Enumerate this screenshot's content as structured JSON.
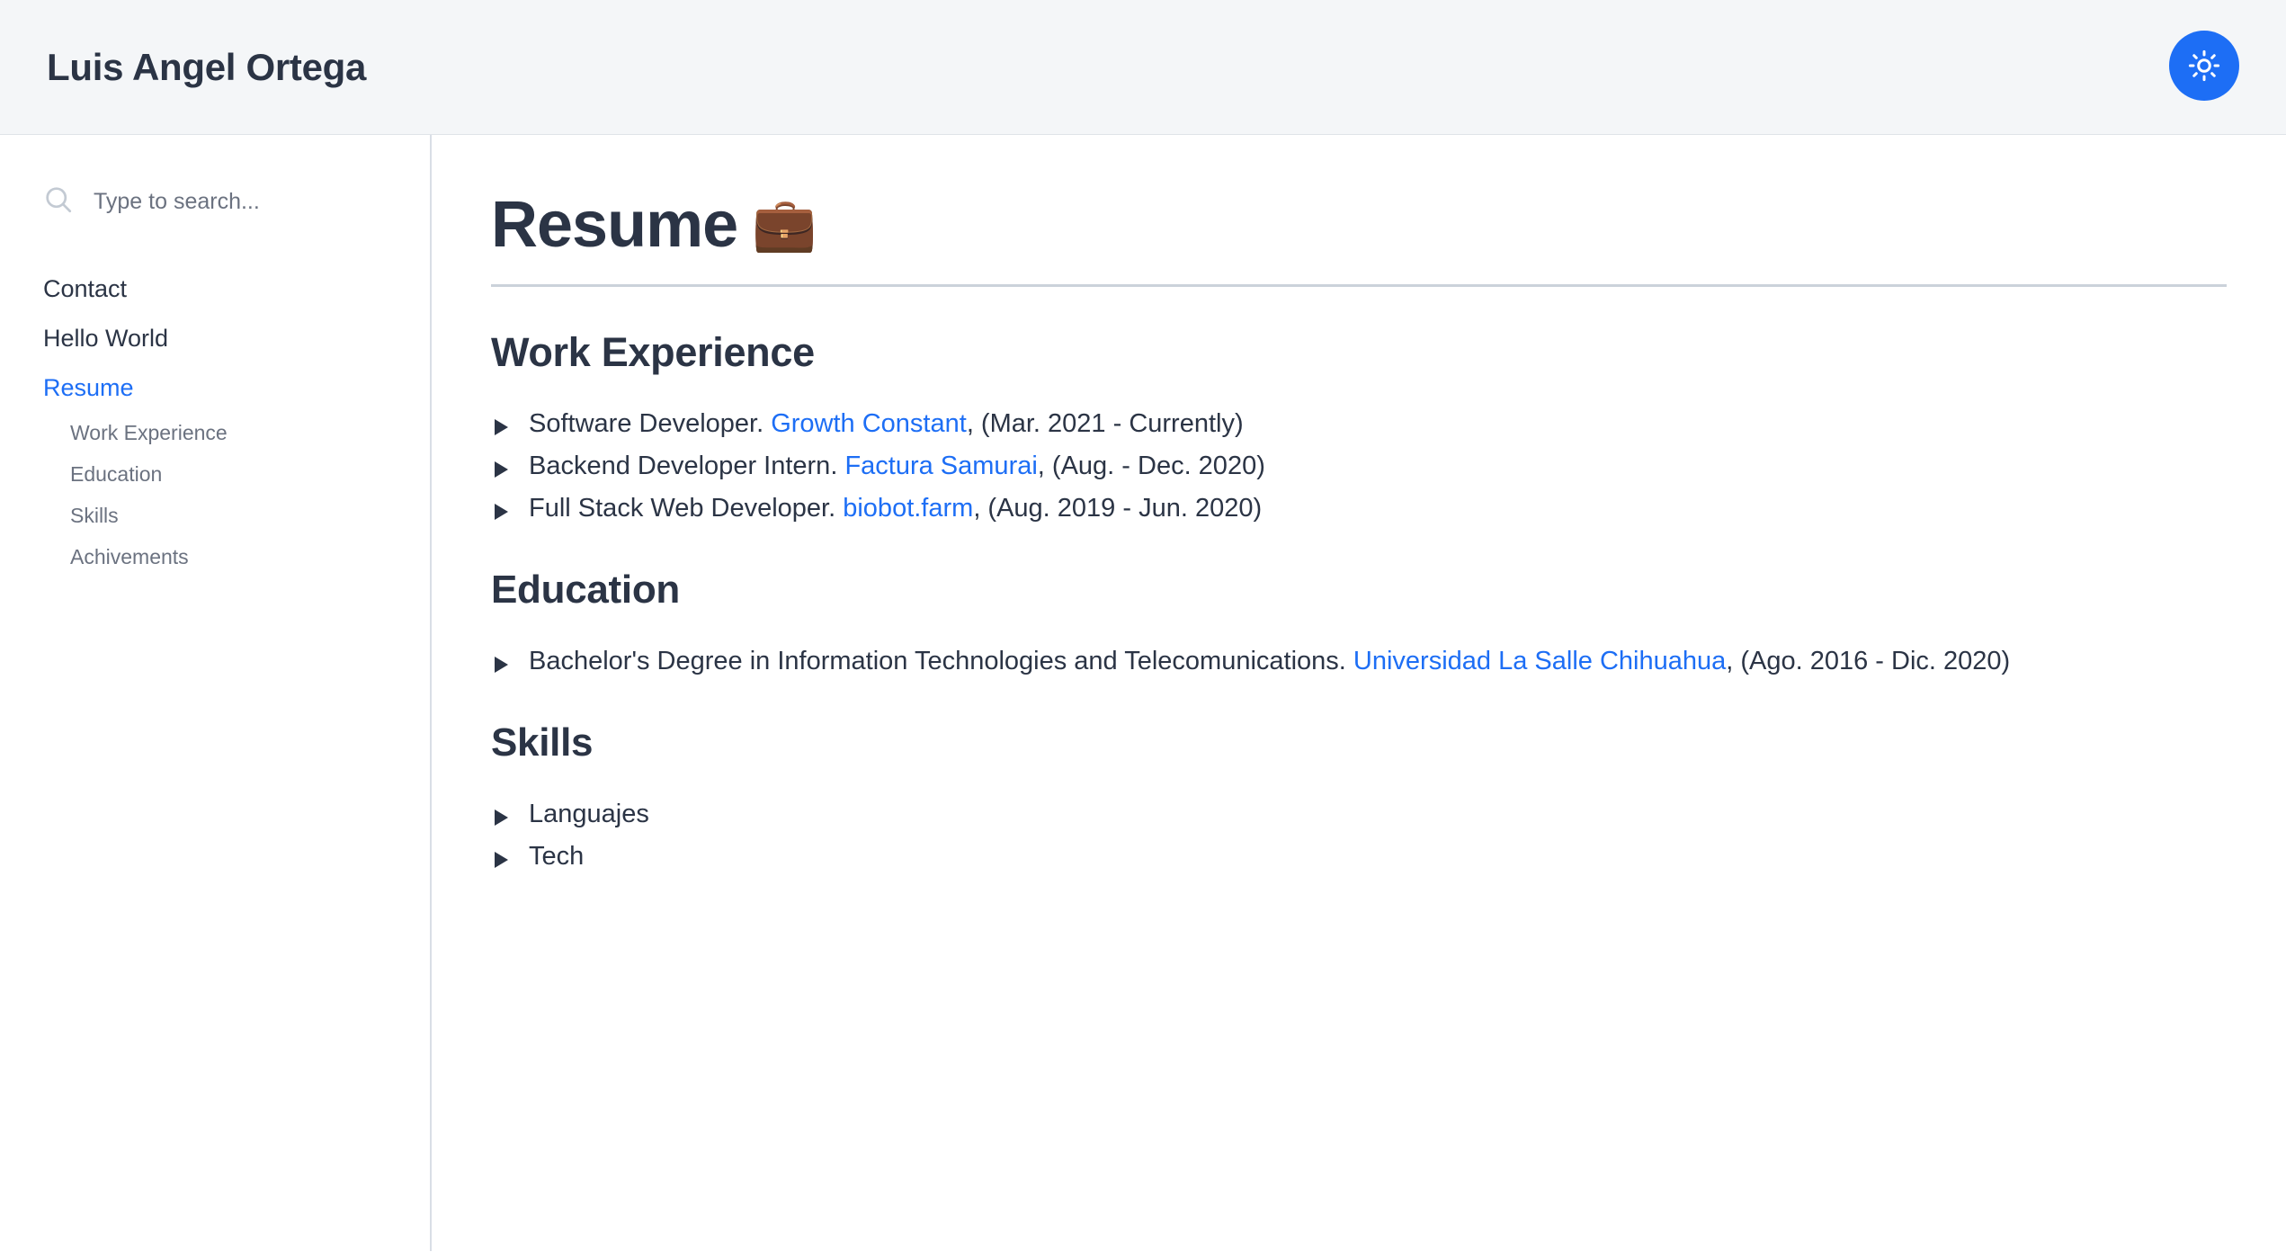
{
  "header": {
    "site_title": "Luis Angel Ortega",
    "theme_toggle": {
      "name": "theme-toggle",
      "icon": "sun-icon",
      "bg_color": "#1d6ef5",
      "icon_color": "#ffffff"
    }
  },
  "sidebar": {
    "search": {
      "placeholder": "Type to search...",
      "value": "",
      "icon": "search-icon"
    },
    "items": [
      {
        "label": "Contact",
        "active": false
      },
      {
        "label": "Hello World",
        "active": false
      },
      {
        "label": "Resume",
        "active": true
      }
    ],
    "sub_items": [
      {
        "label": "Work Experience"
      },
      {
        "label": "Education"
      },
      {
        "label": "Skills"
      },
      {
        "label": "Achivements"
      }
    ]
  },
  "main": {
    "title": "Resume",
    "title_emoji": "💼",
    "sections": [
      {
        "heading": "Work Experience",
        "items": [
          {
            "prefix": "Software Developer. ",
            "link": "Growth Constant",
            "suffix": ", (Mar. 2021 - Currently)"
          },
          {
            "prefix": "Backend Developer Intern. ",
            "link": "Factura Samurai",
            "suffix": ", (Aug. - Dec. 2020)"
          },
          {
            "prefix": "Full Stack Web Developer. ",
            "link": "biobot.farm",
            "suffix": ", (Aug. 2019 - Jun. 2020)"
          }
        ]
      },
      {
        "heading": "Education",
        "items": [
          {
            "prefix": "Bachelor's Degree in Information Technologies and Telecomunications. ",
            "link": "Universidad La Salle Chihuahua",
            "suffix": ", (Ago. 2016 - Dic. 2020)"
          }
        ]
      },
      {
        "heading": "Skills",
        "items": [
          {
            "prefix": "Languajes",
            "link": "",
            "suffix": ""
          },
          {
            "prefix": "Tech",
            "link": "",
            "suffix": ""
          }
        ]
      }
    ]
  },
  "colors": {
    "accent": "#1d6ef5",
    "text": "#2b3445",
    "muted": "#6b7280",
    "header_bg": "#f4f6f8",
    "rule": "#cbd2da",
    "divider": "#d9dee6"
  }
}
